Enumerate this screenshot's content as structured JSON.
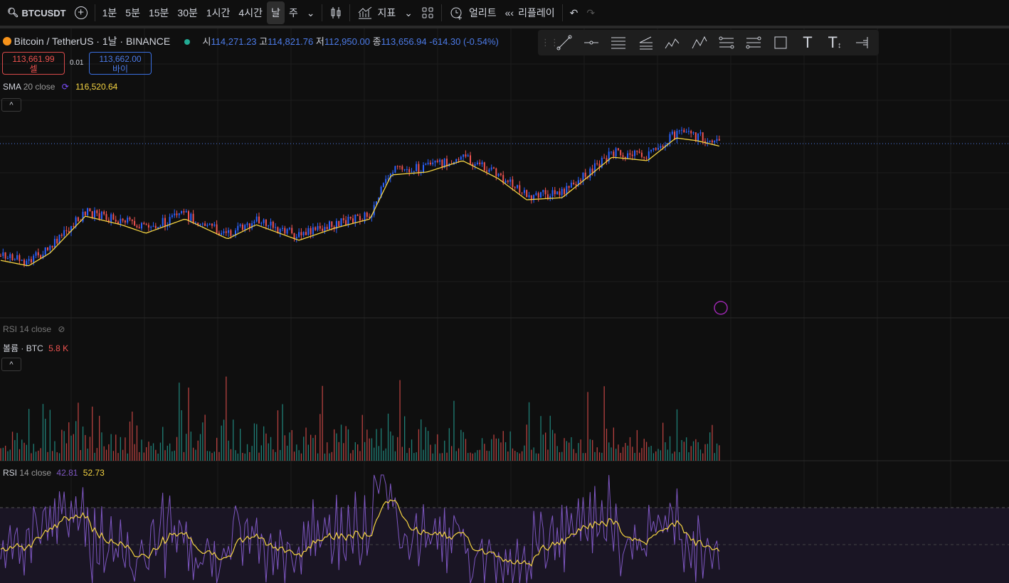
{
  "toolbar": {
    "symbol": "BTCUSDT",
    "intervals": [
      "1분",
      "5분",
      "15분",
      "30분",
      "1시간",
      "4시간",
      "날",
      "주"
    ],
    "active_interval": "날",
    "indicators": "지표",
    "alert": "얼리트",
    "replay": "리플레이"
  },
  "legend": {
    "title": "Bitcoin / TetherUS · 1날 · BINANCE",
    "o_label": "시",
    "o": "114,271.23",
    "h_label": "고",
    "h": "114,821.76",
    "l_label": "저",
    "l": "112,950.00",
    "c_label": "종",
    "c": "113,656.94",
    "change": "-614.30 (-0.54%)"
  },
  "trade": {
    "sell_price": "113,661.99",
    "sell_label": "셀",
    "spread": "0.01",
    "buy_price": "113,662.00",
    "buy_label": "바이"
  },
  "sma": {
    "label": "SMA",
    "params": "20 close",
    "value": "116,520.64"
  },
  "rsi_hidden": {
    "label": "RSI 14 close"
  },
  "volume": {
    "label": "볼륨 · BTC",
    "value": "5.8 K"
  },
  "rsi": {
    "label": "RSI",
    "params": "14 close",
    "value": "42.81",
    "ma_value": "52.73"
  },
  "colors": {
    "up": "#26a69a",
    "down": "#ef5350",
    "candle_up": "#2962ff",
    "sma": "#f5d442",
    "rsi": "#7e57c2",
    "rsi_ma": "#f5d442"
  }
}
